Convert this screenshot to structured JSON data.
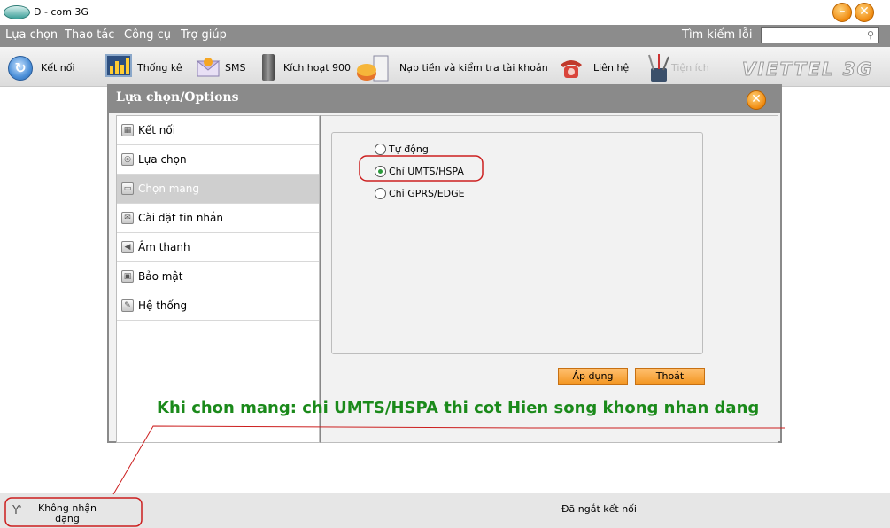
{
  "window": {
    "title": "D - com 3G"
  },
  "menu": {
    "items": [
      "Lựa chọn",
      "Thao tác",
      "Công cụ",
      "Trợ giúp"
    ],
    "search_label": "Tìm kiếm lỗi",
    "search_value": ""
  },
  "toolbar": {
    "connect": "Kết nối",
    "stats": "Thống kê",
    "sms": "SMS",
    "activate": "Kích hoạt 900",
    "topup": "Nạp tiền và kiểm tra tài khoản",
    "contact": "Liên hệ",
    "utilities": "Tiện ích",
    "brand": "VIETTEL 3G"
  },
  "dialog": {
    "title": "Lựa chọn/Options",
    "sidebar": [
      {
        "label": "Kết nối",
        "icon": "connection-icon"
      },
      {
        "label": "Lựa chọn",
        "icon": "options-icon"
      },
      {
        "label": "Chọn mạng",
        "icon": "network-icon"
      },
      {
        "label": "Cài đặt tin nhắn",
        "icon": "message-settings-icon"
      },
      {
        "label": "Âm thanh",
        "icon": "sound-icon"
      },
      {
        "label": "Bảo mật",
        "icon": "lock-icon"
      },
      {
        "label": "Hệ thống",
        "icon": "system-icon"
      }
    ],
    "active_item": "Chọn mạng",
    "network_options": [
      {
        "label": "Tự động",
        "checked": false
      },
      {
        "label": "Chỉ UMTS/HSPA",
        "checked": true
      },
      {
        "label": "Chỉ GPRS/EDGE",
        "checked": false
      }
    ],
    "apply": "Áp dụng",
    "exit": "Thoát"
  },
  "annotation": {
    "text": "Khi chon mang: chi UMTS/HSPA thi cot Hien song khong nhan dang",
    "color": "#1b8a1b",
    "highlight_color": "#cc1f1f"
  },
  "status": {
    "signal": "Không nhận dạng",
    "connection": "Đã ngắt kết nối"
  }
}
